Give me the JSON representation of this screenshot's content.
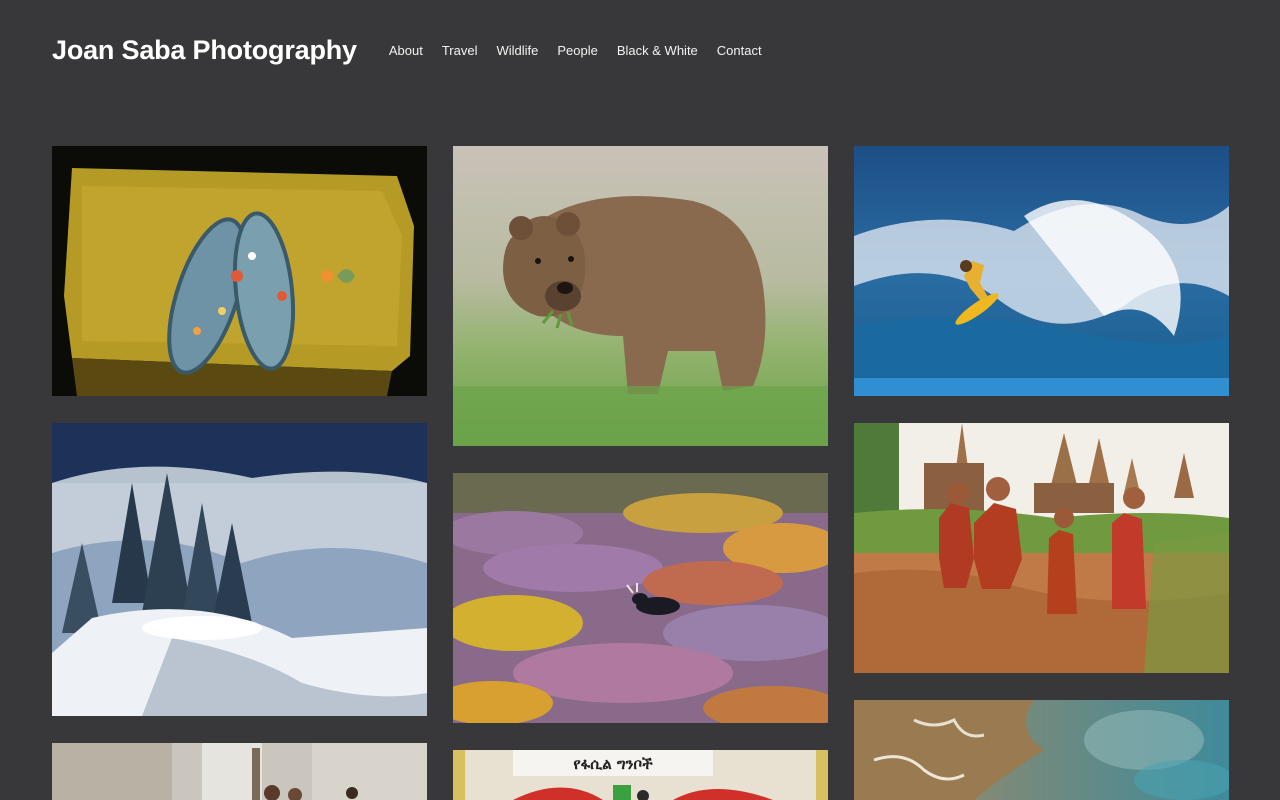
{
  "site": {
    "title": "Joan Saba Photography"
  },
  "nav": {
    "items": [
      {
        "label": "About"
      },
      {
        "label": "Travel"
      },
      {
        "label": "Wildlife"
      },
      {
        "label": "People"
      },
      {
        "label": "Black & White"
      },
      {
        "label": "Contact"
      }
    ]
  },
  "gallery": {
    "photos": [
      {
        "subject": "flip-flop sandals on a yellow stone with flower offerings"
      },
      {
        "subject": "brown bear standing in green grass"
      },
      {
        "subject": "surfer riding a large blue wave"
      },
      {
        "subject": "snowy forest with mist over a river"
      },
      {
        "subject": "moose lying in autumn tundra"
      },
      {
        "subject": "young monks in red robes jumping near stupas"
      },
      {
        "subject": "street market scene"
      },
      {
        "subject": "painted wall with Amharic lettering",
        "sign_text": "የፋሲል ግንቦች"
      },
      {
        "subject": "aerial view of turquoise water and coastline"
      }
    ]
  },
  "colors": {
    "background": "#38383a",
    "text": "#ffffff"
  }
}
